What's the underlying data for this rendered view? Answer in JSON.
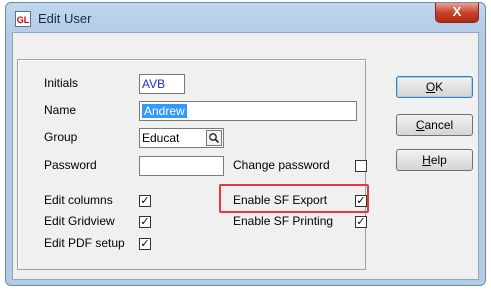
{
  "window": {
    "title": "Edit User",
    "app_icon_text": "GL",
    "close_label": "X"
  },
  "form": {
    "initials": {
      "label": "Initials",
      "value": "AVB"
    },
    "name": {
      "label": "Name",
      "value": "Andrew"
    },
    "group": {
      "label": "Group",
      "value": "Educat",
      "lookup_icon": "search-icon"
    },
    "password": {
      "label": "Password",
      "value": ""
    },
    "change_password": {
      "label": "Change password",
      "checked": false
    },
    "edit_columns": {
      "label": "Edit columns",
      "checked": true
    },
    "edit_gridview": {
      "label": "Edit Gridview",
      "checked": true
    },
    "edit_pdf_setup": {
      "label": "Edit PDF setup",
      "checked": true
    },
    "enable_sf_export": {
      "label": "Enable SF Export",
      "checked": true
    },
    "enable_sf_printing": {
      "label": "Enable SF Printing",
      "checked": true
    }
  },
  "buttons": {
    "ok": {
      "mnemonic": "O",
      "rest": "K"
    },
    "cancel": {
      "mnemonic": "C",
      "rest": "ancel"
    },
    "help": {
      "mnemonic": "H",
      "rest": "elp"
    }
  },
  "check_glyph": "✓",
  "colors": {
    "highlight_border": "#e23b3b",
    "selection": "#3399ff",
    "close_button": "#c7432b"
  }
}
